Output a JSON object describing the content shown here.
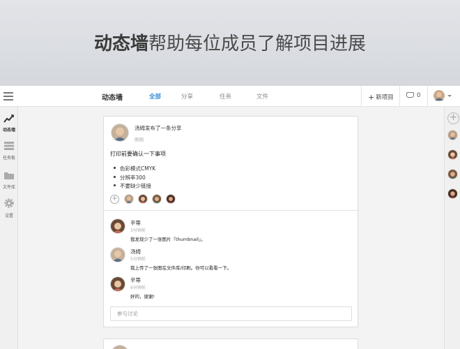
{
  "banner": {
    "headline_bold": "动态墙",
    "headline_rest": "帮助每位成员了解项目进展"
  },
  "header": {
    "title": "动态墙",
    "tabs": [
      {
        "label": "全部",
        "active": true
      },
      {
        "label": "分享"
      },
      {
        "label": "任务"
      },
      {
        "label": "文件"
      }
    ],
    "new_item_label": "新项目",
    "inbox_count": "0"
  },
  "sidebar": {
    "items": [
      {
        "label": "动态墙",
        "icon": "activity-icon",
        "active": true
      },
      {
        "label": "任务板",
        "icon": "board-icon"
      },
      {
        "label": "文件库",
        "icon": "folder-icon"
      },
      {
        "label": "设置",
        "icon": "gear-icon"
      }
    ]
  },
  "post": {
    "author_line": "汤姆发布了一条分享",
    "time": "刚刚",
    "title": "打印前要确认一下事项",
    "bullets": [
      "色彩模式CMYK",
      "分辨率300",
      "不要缺少链接"
    ]
  },
  "comments": [
    {
      "author": "辛蒂",
      "time": "3分钟前",
      "text": "我发现少了一张图片『thumbnail』。"
    },
    {
      "author": "汤姆",
      "time": "5分钟前",
      "text": "我上传了一张图在文件库/印刷。你可以看看一下。"
    },
    {
      "author": "辛蒂",
      "time": "6分钟前",
      "text": "好的，谢谢!"
    }
  ],
  "discussion_placeholder": "参与讨论",
  "colors": {
    "accent": "#3a8fd6",
    "banner_top": "#e2e4e8",
    "banner_bottom": "#d5d8dd"
  }
}
